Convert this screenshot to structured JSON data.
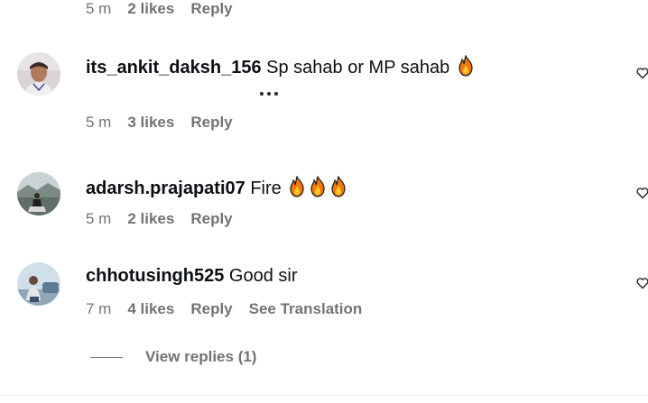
{
  "top_meta": {
    "time": "5 m",
    "likes": "2 likes",
    "reply": "Reply"
  },
  "comments": [
    {
      "username": "its_ankit_daksh_156",
      "text": "Sp sahab or MP sahab",
      "emoji": "fire",
      "fire_count": 1,
      "time": "5 m",
      "likes": "3 likes",
      "reply": "Reply"
    },
    {
      "username": "adarsh.prajapati07",
      "text": "Fire",
      "emoji": "fire",
      "fire_count": 3,
      "time": "5 m",
      "likes": "2 likes",
      "reply": "Reply"
    },
    {
      "username": "chhotusingh525",
      "text": "Good sir",
      "time": "7 m",
      "likes": "4 likes",
      "reply": "Reply",
      "see_translation": "See Translation",
      "view_replies": "View replies (1)"
    }
  ],
  "icons": {
    "like": "heart-icon",
    "more": "more-options-icon",
    "emoji": "fire-emoji-icon"
  },
  "colors": {
    "meta_text": "#737373",
    "primary_text": "#0c1014",
    "fire_outer": "#f2780c",
    "fire_inner": "#ffca28"
  }
}
